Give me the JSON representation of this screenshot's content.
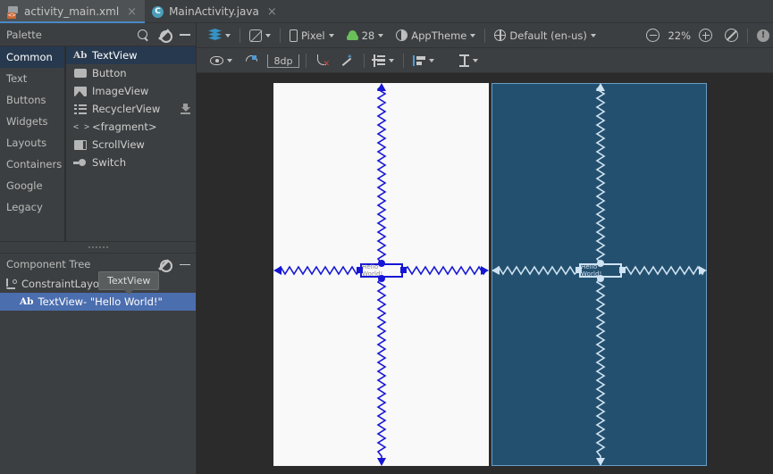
{
  "tabs": [
    {
      "label": "activity_main.xml",
      "icon": "xml-file-icon",
      "active": true,
      "close": "×"
    },
    {
      "label": "MainActivity.java",
      "icon": "java-class-icon",
      "active": false,
      "close": "×"
    }
  ],
  "toolbar_main": {
    "design_mode_icon": "layers-icon",
    "orientation_icon": "rotate-device-icon",
    "device_label": "Pixel",
    "device_icon": "phone-icon",
    "api_label": "28",
    "api_icon": "android-icon",
    "theme_label": "AppTheme",
    "theme_icon": "theme-contrast-icon",
    "locale_label": "Default (en-us)",
    "locale_icon": "globe-icon",
    "zoom_out_icon": "zoom-out-icon",
    "zoom_level": "22%",
    "zoom_in_icon": "zoom-in-icon",
    "zoom_fit_icon": "zoom-fit-icon",
    "warning_icon": "warning-badge-icon",
    "warning_glyph": "!"
  },
  "toolbar_design": {
    "visibility_icon": "eye-icon",
    "autoconnect_icon": "autoconnect-magnet-icon",
    "default_margin": "8dp",
    "clear_constraints_icon": "clear-constraints-icon",
    "infer_constraints_icon": "infer-constraints-magic-icon",
    "pack_icon": "pack-distribute-icon",
    "align_icon": "align-icon",
    "guidelines_icon": "guidelines-icon"
  },
  "palette": {
    "title": "Palette",
    "search_icon": "search-icon",
    "gear_icon": "gear-icon",
    "minimize_icon": "minimize-icon",
    "categories": [
      {
        "label": "Common",
        "selected": true
      },
      {
        "label": "Text",
        "selected": false
      },
      {
        "label": "Buttons",
        "selected": false
      },
      {
        "label": "Widgets",
        "selected": false
      },
      {
        "label": "Layouts",
        "selected": false
      },
      {
        "label": "Containers",
        "selected": false
      },
      {
        "label": "Google",
        "selected": false
      },
      {
        "label": "Legacy",
        "selected": false
      }
    ],
    "items": [
      {
        "label": "TextView",
        "icon": "textview-icon",
        "selected": true,
        "download": false
      },
      {
        "label": "Button",
        "icon": "button-icon",
        "selected": false,
        "download": false
      },
      {
        "label": "ImageView",
        "icon": "imageview-icon",
        "selected": false,
        "download": false
      },
      {
        "label": "RecyclerView",
        "icon": "recyclerview-icon",
        "selected": false,
        "download": true
      },
      {
        "label": "<fragment>",
        "icon": "fragment-icon",
        "selected": false,
        "download": false
      },
      {
        "label": "ScrollView",
        "icon": "scrollview-icon",
        "selected": false,
        "download": false
      },
      {
        "label": "Switch",
        "icon": "switch-icon",
        "selected": false,
        "download": false
      }
    ],
    "download_icon": "download-icon"
  },
  "component_tree": {
    "title": "Component Tree",
    "gear_icon": "gear-icon",
    "minimize_icon": "minimize-icon",
    "rows": [
      {
        "label": "ConstraintLayout",
        "icon": "constraintlayout-icon",
        "selected": false,
        "badge": ""
      },
      {
        "label": "TextView- \"Hello World!\"",
        "icon": "textview-icon",
        "selected": true,
        "badge": "Ab"
      }
    ],
    "tooltip": "TextView"
  },
  "canvas": {
    "devices": [
      {
        "name": "design-surface-render",
        "widget_text": "Hello World!",
        "theme": "light"
      },
      {
        "name": "design-surface-blueprint",
        "widget_text": "Hello World!",
        "theme": "blueprint"
      }
    ],
    "constraint_color_light": "#1616d6",
    "constraint_color_blueprint": "#cfe3f2"
  }
}
